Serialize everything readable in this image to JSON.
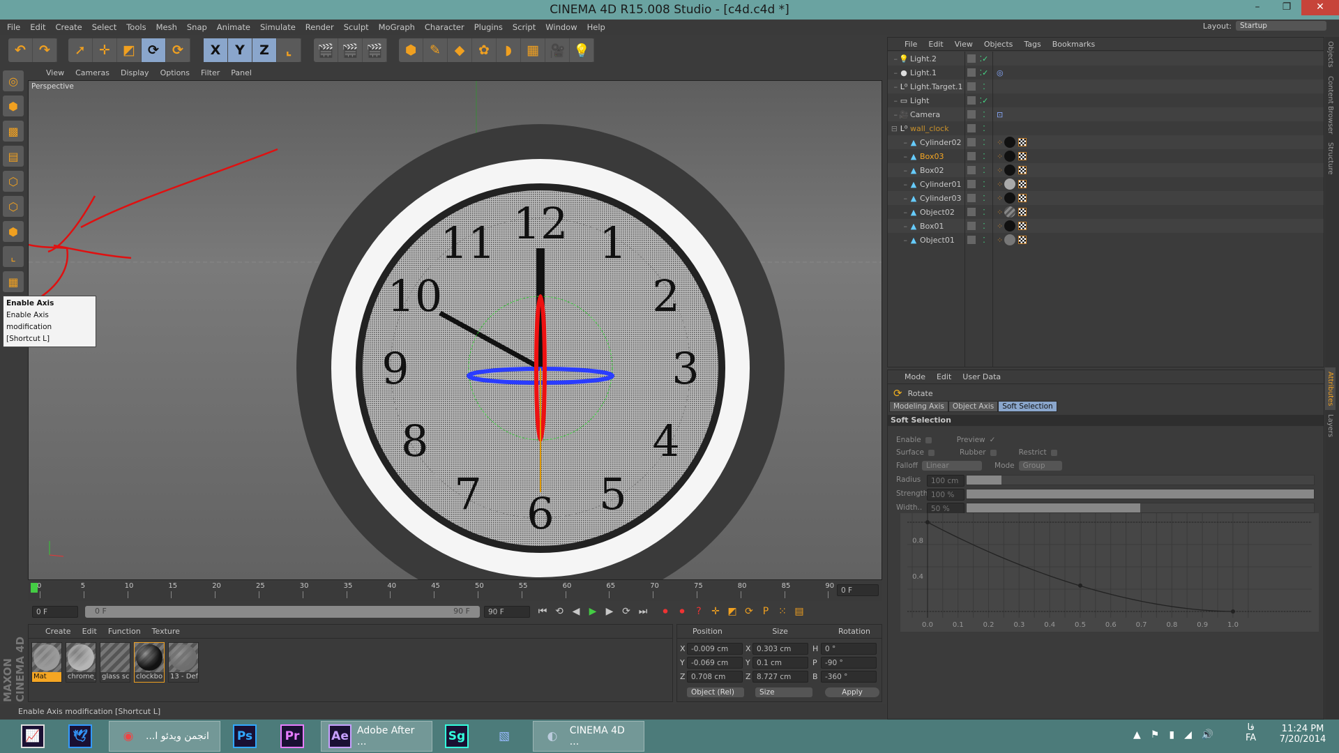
{
  "window": {
    "title": "CINEMA 4D R15.008 Studio - [c4d.c4d *]",
    "controls": [
      "–",
      "❐",
      "✕"
    ]
  },
  "menu": [
    "File",
    "Edit",
    "Create",
    "Select",
    "Tools",
    "Mesh",
    "Snap",
    "Animate",
    "Simulate",
    "Render",
    "Sculpt",
    "MoGraph",
    "Character",
    "Plugins",
    "Script",
    "Window",
    "Help"
  ],
  "layout": {
    "label": "Layout:",
    "value": "Startup"
  },
  "toolbar": {
    "groups": [
      {
        "icons": [
          {
            "name": "undo-icon",
            "glyph": "↶"
          },
          {
            "name": "redo-icon",
            "glyph": "↷"
          }
        ]
      },
      {
        "icons": [
          {
            "name": "live-selection-icon",
            "glyph": "➚"
          },
          {
            "name": "move-icon",
            "glyph": "✛"
          },
          {
            "name": "scale-icon",
            "glyph": "◩"
          },
          {
            "name": "rotate-icon",
            "glyph": "⟳",
            "on": true
          },
          {
            "name": "recent-tool-icon",
            "glyph": "⟳"
          }
        ]
      },
      {
        "icons": [
          {
            "name": "x-axis-icon",
            "glyph": "X",
            "on": true
          },
          {
            "name": "y-axis-icon",
            "glyph": "Y",
            "on": true
          },
          {
            "name": "z-axis-icon",
            "glyph": "Z",
            "on": true
          },
          {
            "name": "coordinate-system-icon",
            "glyph": "⌞"
          }
        ]
      },
      {
        "icons": [
          {
            "name": "render-view-icon",
            "glyph": "🎬"
          },
          {
            "name": "render-picture-viewer-icon",
            "glyph": "🎬"
          },
          {
            "name": "edit-render-settings-icon",
            "glyph": "🎬"
          }
        ]
      },
      {
        "icons": [
          {
            "name": "cube-icon",
            "glyph": "⬢"
          },
          {
            "name": "spline-pen-icon",
            "glyph": "✎"
          },
          {
            "name": "subdivision-surface-icon",
            "glyph": "◆"
          },
          {
            "name": "array-icon",
            "glyph": "✿"
          },
          {
            "name": "bend-deformer-icon",
            "glyph": "◗"
          },
          {
            "name": "floor-icon",
            "glyph": "▦"
          },
          {
            "name": "camera-icon",
            "glyph": "🎥"
          },
          {
            "name": "light-icon",
            "glyph": "💡"
          }
        ]
      }
    ]
  },
  "left_tools": [
    {
      "name": "make-editable-icon",
      "glyph": "◎"
    },
    {
      "name": "model-mode-icon",
      "glyph": "⬢"
    },
    {
      "name": "texture-mode-icon",
      "glyph": "▩"
    },
    {
      "name": "workplane-icon",
      "glyph": "▤"
    },
    {
      "name": "points-mode-icon",
      "glyph": "⬡"
    },
    {
      "name": "edges-mode-icon",
      "glyph": "⬡"
    },
    {
      "name": "polygons-mode-icon",
      "glyph": "⬢"
    },
    {
      "name": "enable-axis-icon",
      "glyph": "⌞"
    },
    {
      "name": "tweak-icon",
      "glyph": "▦"
    },
    {
      "name": "snap-icon",
      "glyph": "U"
    }
  ],
  "tooltip": {
    "title": "Enable Axis",
    "desc": "Enable Axis modification",
    "shortcut": "[Shortcut L]"
  },
  "viewport": {
    "menu": [
      "View",
      "Cameras",
      "Display",
      "Options",
      "Filter",
      "Panel"
    ],
    "label": "Perspective",
    "clock_numbers": [
      "12",
      "1",
      "2",
      "3",
      "4",
      "5",
      "6",
      "7",
      "8",
      "9",
      "10",
      "11"
    ]
  },
  "timeline": {
    "ticks": [
      "0",
      "5",
      "10",
      "15",
      "20",
      "25",
      "30",
      "35",
      "40",
      "45",
      "50",
      "55",
      "60",
      "65",
      "70",
      "75",
      "80",
      "85",
      "90"
    ],
    "current_frame": "0 F",
    "start": "0 F",
    "range_start": "0 F",
    "range_end": "90 F",
    "end": "90 F"
  },
  "materials": {
    "menu": [
      "Create",
      "Edit",
      "Function",
      "Texture"
    ],
    "items": [
      {
        "label": "Mat",
        "color": "#9a9a9a",
        "selected": true
      },
      {
        "label": "chrome_",
        "color": "#b5b5b5"
      },
      {
        "label": "glass sci",
        "color": "transparent"
      },
      {
        "label": "clockbo",
        "color": "#111111",
        "active": true
      },
      {
        "label": "13 - Def",
        "color": "#6e6e6e"
      }
    ]
  },
  "coords": {
    "headers": [
      "Position",
      "Size",
      "Rotation"
    ],
    "rows": [
      {
        "axis": "X",
        "pos": "-0.009 cm",
        "saxis": "X",
        "size": "0.303 cm",
        "raxis": "H",
        "rot": "0 °"
      },
      {
        "axis": "Y",
        "pos": "-0.069 cm",
        "saxis": "Y",
        "size": "0.1 cm",
        "raxis": "P",
        "rot": "-90 °"
      },
      {
        "axis": "Z",
        "pos": "0.708 cm",
        "saxis": "Z",
        "size": "8.727 cm",
        "raxis": "B",
        "rot": "-360 °"
      }
    ],
    "mode": "Object (Rel)",
    "size_mode": "Size",
    "apply": "Apply"
  },
  "status": "Enable Axis modification [Shortcut L]",
  "objects": {
    "menu": [
      "File",
      "Edit",
      "View",
      "Objects",
      "Tags",
      "Bookmarks"
    ],
    "rows": [
      {
        "name": "Light.2",
        "icon": "light-bulb-icon",
        "glyph": "💡",
        "check": true,
        "indent": 0
      },
      {
        "name": "Light.1",
        "icon": "spot-light-icon",
        "glyph": "●",
        "check": true,
        "indent": 0,
        "tag": "target-tag"
      },
      {
        "name": "Light.Target.1",
        "icon": "null-icon",
        "glyph": "L⁰",
        "indent": 0
      },
      {
        "name": "Light",
        "icon": "area-light-icon",
        "glyph": "▭",
        "check": true,
        "indent": 0
      },
      {
        "name": "Camera",
        "icon": "camera-icon",
        "glyph": "🎥",
        "indent": 0,
        "tag": "protection-tag"
      },
      {
        "name": "wall_clock",
        "icon": "null-icon",
        "glyph": "L⁰",
        "indent": 0,
        "group": true
      },
      {
        "name": "Cylinder02",
        "icon": "polygon-object-icon",
        "glyph": "▲",
        "indent": 1,
        "mat": "#111"
      },
      {
        "name": "Box03",
        "icon": "polygon-object-icon",
        "glyph": "▲",
        "indent": 1,
        "mat": "#111",
        "selected": true
      },
      {
        "name": "Box02",
        "icon": "polygon-object-icon",
        "glyph": "▲",
        "indent": 1,
        "mat": "#111"
      },
      {
        "name": "Cylinder01",
        "icon": "polygon-object-icon",
        "glyph": "▲",
        "indent": 1,
        "mat": "#aaa"
      },
      {
        "name": "Cylinder03",
        "icon": "polygon-object-icon",
        "glyph": "▲",
        "indent": 1,
        "mat": "#111"
      },
      {
        "name": "Object02",
        "icon": "polygon-object-icon",
        "glyph": "▲",
        "indent": 1,
        "mat": "stripe"
      },
      {
        "name": "Box01",
        "icon": "polygon-object-icon",
        "glyph": "▲",
        "indent": 1,
        "mat": "#111"
      },
      {
        "name": "Object01",
        "icon": "polygon-object-icon",
        "glyph": "▲",
        "indent": 1,
        "mat": "#777"
      }
    ]
  },
  "attributes": {
    "menu": [
      "Mode",
      "Edit",
      "User Data"
    ],
    "tool": "Rotate",
    "tabs": [
      {
        "label": "Modeling Axis"
      },
      {
        "label": "Object Axis"
      },
      {
        "label": "Soft Selection",
        "on": true
      }
    ],
    "section": "Soft Selection",
    "enable": "Enable",
    "preview": "Preview",
    "surface": "Surface",
    "rubber": "Rubber",
    "restrict": "Restrict",
    "falloff_label": "Falloff",
    "falloff": "Linear",
    "mode_label": "Mode",
    "mode": "Group",
    "radius_label": "Radius",
    "radius": "100 cm",
    "radius_fill": 0.1,
    "strength_label": "Strength",
    "strength": "100 %",
    "strength_fill": 1.0,
    "width_label": "Width..",
    "width": "50 %",
    "width_fill": 0.5,
    "curve": {
      "x": [
        0,
        0.5,
        1.0
      ],
      "y": [
        1.0,
        0.29,
        0
      ],
      "xticks": [
        "0.0",
        "0.1",
        "0.2",
        "0.3",
        "0.4",
        "0.5",
        "0.6",
        "0.7",
        "0.8",
        "0.9",
        "1.0"
      ],
      "yticks": [
        "0.8",
        "0.4"
      ]
    }
  },
  "side_tabs": [
    "Objects",
    "Content Browser",
    "Structure",
    "Attributes",
    "Layers"
  ],
  "taskbar": {
    "items": [
      {
        "label": "",
        "icon": "resource-monitor-icon",
        "glyph": "📈",
        "color": "#ddd"
      },
      {
        "label": "",
        "icon": "bird-app-icon",
        "glyph": "🕊",
        "color": "#39f"
      },
      {
        "label": "...انجمن ویدئو ا",
        "icon": "chrome-icon",
        "glyph": "◉",
        "color": "#e44",
        "open": true
      },
      {
        "label": "",
        "icon": "photoshop-icon",
        "glyph": "Ps",
        "color": "#31a8ff"
      },
      {
        "label": "",
        "icon": "premiere-icon",
        "glyph": "Pr",
        "color": "#e77cff"
      },
      {
        "label": "Adobe After ...",
        "icon": "after-effects-icon",
        "glyph": "Ae",
        "color": "#c7a0ff",
        "open": true
      },
      {
        "label": "",
        "icon": "speedgrade-icon",
        "glyph": "Sg",
        "color": "#3fd"
      },
      {
        "label": "",
        "icon": "app-icon",
        "glyph": "▧",
        "color": "#9bf"
      },
      {
        "label": "CINEMA 4D ...",
        "icon": "cinema4d-icon",
        "glyph": "◐",
        "color": "#bcd",
        "open": true
      }
    ],
    "lang": "FA",
    "lang2": "فا",
    "time": "11:24 PM",
    "date": "7/20/2014"
  }
}
